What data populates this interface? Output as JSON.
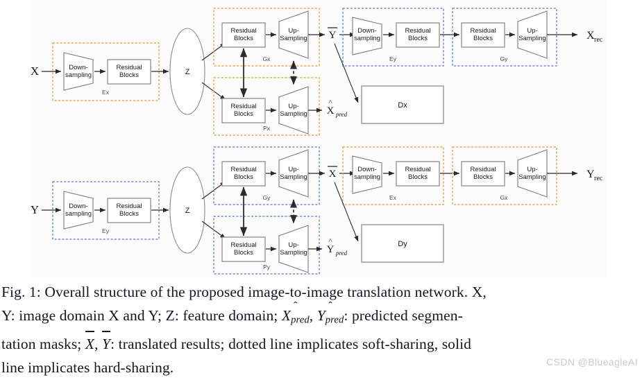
{
  "figure": {
    "background": "#fcfcfc",
    "colors": {
      "orange_dashed": "#e8a64a",
      "blue_dashed": "#7289e0",
      "box_stroke": "#7a7a7a",
      "arrow": "#2b2b2b",
      "text": "#1a1a1a"
    },
    "io_labels": {
      "x_in": "X",
      "y_in": "Y",
      "x_rec": "X",
      "x_rec_sub": "rec",
      "y_rec": "Y",
      "y_rec_sub": "rec",
      "y_bar": "Y",
      "x_bar": "X",
      "x_pred": "X",
      "x_pred_sub": "pred",
      "y_pred": "Y",
      "y_pred_sub": "pred"
    },
    "latent": {
      "top": "Z",
      "bottom": "Z"
    },
    "block_labels": {
      "downsampling": "Down-sampling",
      "downsampling_l1": "Down-",
      "downsampling_l2": "sampling",
      "residual_l1": "Residual",
      "residual_l2": "Blocks",
      "upsampling_l1": "Up-",
      "upsampling_l2": "Sampling"
    },
    "group_tags": {
      "row1_encoder": "Ex",
      "row1_gen": "Gx",
      "row1_seg": "Px",
      "row1_enc2": "Ey",
      "row1_gen2": "Gy",
      "row2_encoder": "Ey",
      "row2_gen": "Gy",
      "row2_seg": "Py",
      "row2_enc2": "Ex",
      "row2_gen2": "Gx"
    },
    "discriminators": {
      "top": "Dx",
      "bottom": "Dy"
    }
  },
  "caption": {
    "line1_a": "Fig. 1: Overall structure of the proposed image-to-image translation network. X,",
    "line2_a": "Y: image domain X and Y; Z: feature domain; ",
    "line2_b": ", ",
    "line2_c": ": predicted segmen-",
    "line3_a": "tation masks; ",
    "line3_b": ", ",
    "line3_c": ": translated results; dotted line implicates soft-sharing, solid",
    "line4_a": "line implicates hard-sharing.",
    "sym_xhat": "X",
    "sym_yhat": "Y",
    "sym_pred": "pred",
    "sym_xbar": "X",
    "sym_ybar": "Y",
    "watermark": "CSDN @BlueagleAI"
  }
}
